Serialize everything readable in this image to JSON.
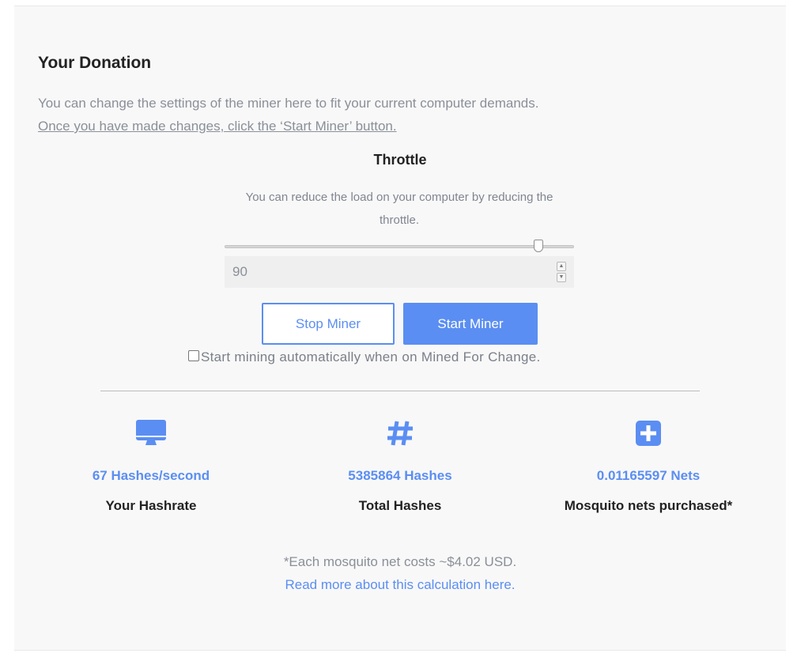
{
  "donation": {
    "title": "Your Donation",
    "description": "You can change the settings of the miner here to fit your current computer demands.",
    "instruction_link": "Once you have made changes, click the ‘Start Miner’ button."
  },
  "throttle": {
    "title": "Throttle",
    "description": "You can reduce the load on your computer by reducing the throttle.",
    "slider_value": 90,
    "slider_max": 100,
    "input_value": "90"
  },
  "buttons": {
    "stop_label": "Stop Miner",
    "start_label": "Start Miner"
  },
  "auto_mine": {
    "label": "Start mining automatically when on Mined For Change.",
    "checked": false
  },
  "stats": [
    {
      "icon": "monitor-icon",
      "value": "67 Hashes/second",
      "label": "Your Hashrate"
    },
    {
      "icon": "hash-icon",
      "value": "5385864 Hashes",
      "label": "Total Hashes"
    },
    {
      "icon": "plus-square-icon",
      "value": "0.01165597 Nets",
      "label": "Mosquito nets purchased*"
    }
  ],
  "footnote": {
    "text": "*Each mosquito net costs ~$4.02 USD.",
    "link": "Read more about this calculation here."
  },
  "colors": {
    "accent": "#5b8ef2",
    "panel_bg": "#f8f8f8"
  }
}
